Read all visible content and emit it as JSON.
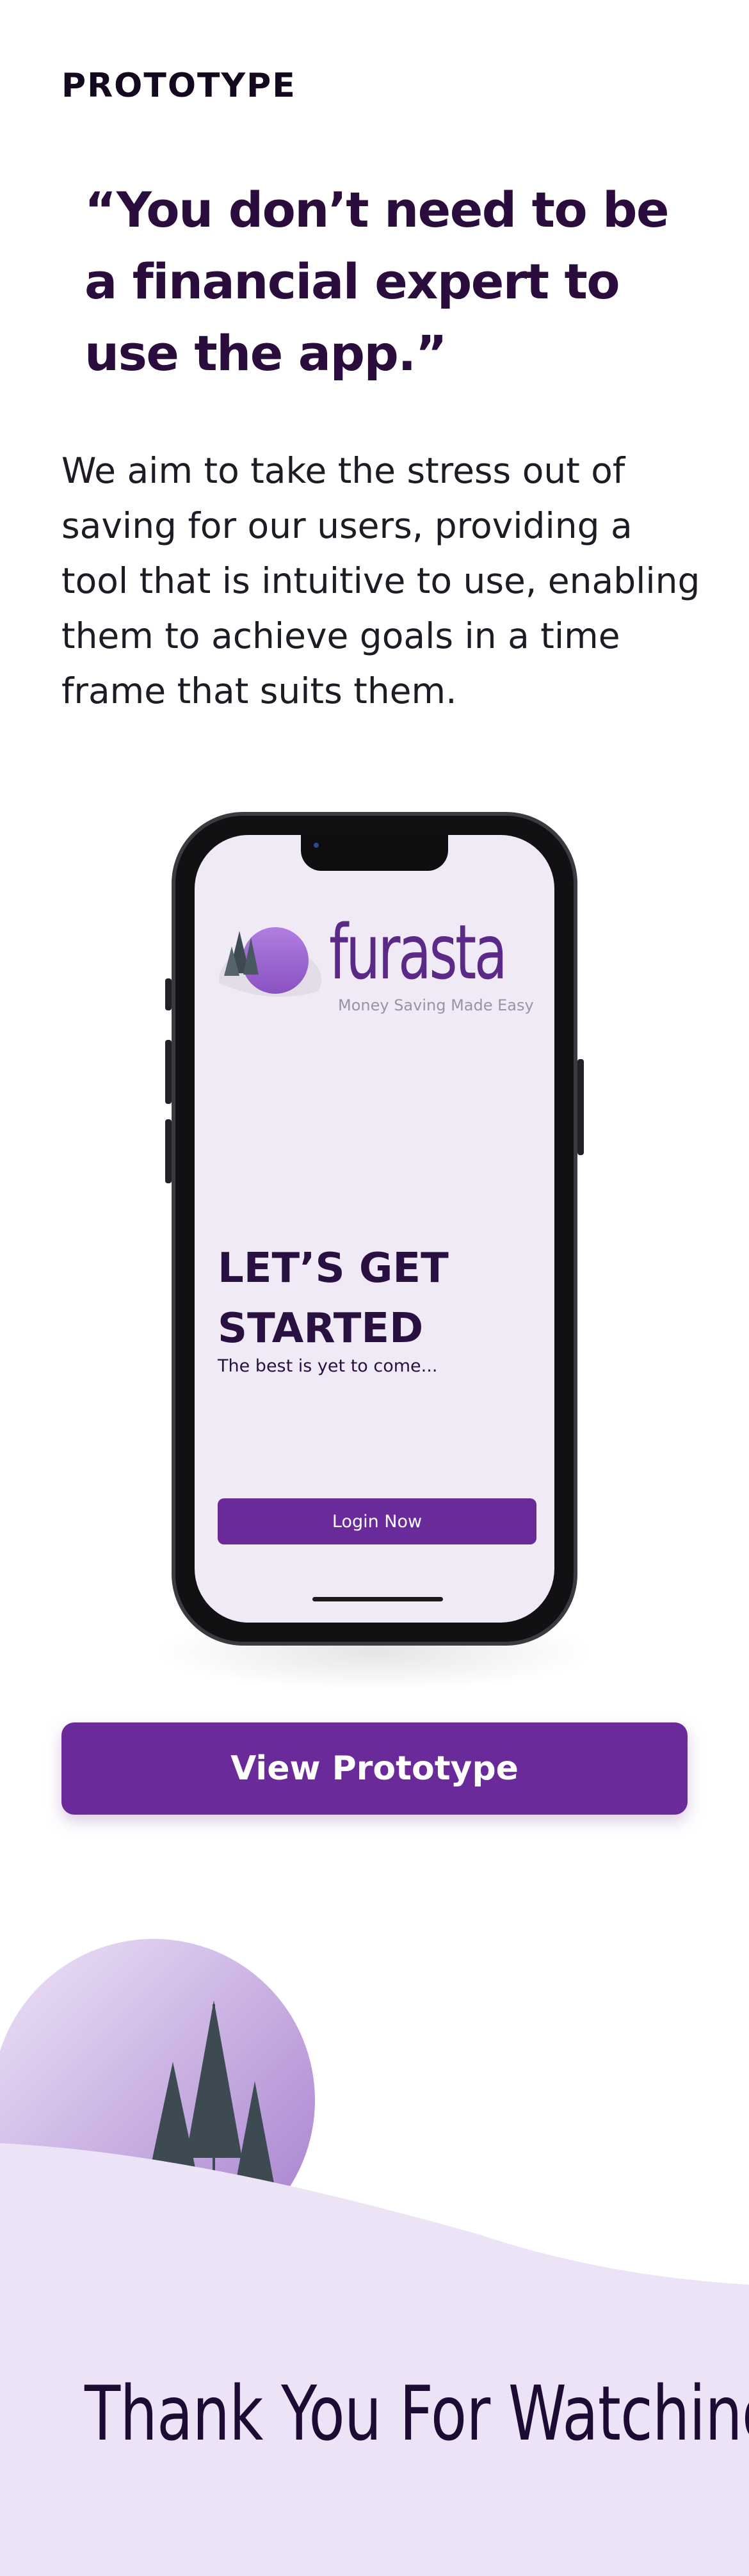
{
  "section": {
    "label": "PROTOTYPE"
  },
  "quote": {
    "text": "“You don’t need to be a financial expert to use the app.”"
  },
  "body": {
    "text": "We aim to take the stress out of saving for our users, providing a tool that is intuitive to use, enabling them to achieve goals in a time frame that suits them."
  },
  "phone": {
    "brand_name": "furasta",
    "brand_tagline": "Money Saving Made Easy",
    "heading": "LET’S GET STARTED",
    "subheading": "The best is yet to come...",
    "login_label": "Login Now"
  },
  "cta": {
    "view_prototype_label": "View Prototype"
  },
  "footer": {
    "thanks": "Thank You For Watching"
  },
  "colors": {
    "accent": "#6a2a9a",
    "heading": "#2a0c3d",
    "screen_bg": "#f0eaf6",
    "hill": "#ece4f6",
    "tree": "#3d4a52"
  }
}
